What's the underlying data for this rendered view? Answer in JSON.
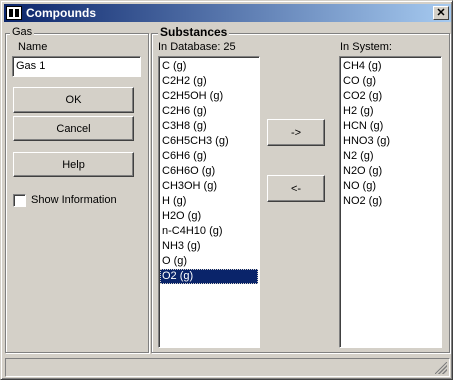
{
  "window": {
    "title": "Compounds"
  },
  "gas_group": {
    "caption": "Gas",
    "name_label": "Name",
    "name_value": "Gas 1"
  },
  "buttons": {
    "ok": "OK",
    "cancel": "Cancel",
    "help": "Help",
    "add": "->",
    "remove": "<-"
  },
  "checkbox": {
    "label": "Show Information",
    "checked": false
  },
  "substances": {
    "heading": "Substances",
    "database_label": "In Database: 25",
    "system_label": "In System:",
    "database_items": [
      "C (g)",
      "C2H2 (g)",
      "C2H5OH (g)",
      "C2H6 (g)",
      "C3H8 (g)",
      "C6H5CH3 (g)",
      "C6H6 (g)",
      "C6H6O (g)",
      "CH3OH (g)",
      "H (g)",
      "H2O (g)",
      "n-C4H10 (g)",
      "NH3 (g)",
      "O (g)",
      "O2 (g)"
    ],
    "database_selected": "O2 (g)",
    "system_items": [
      "CH4 (g)",
      "CO (g)",
      "CO2 (g)",
      "H2 (g)",
      "HCN (g)",
      "HNO3 (g)",
      "N2 (g)",
      "N2O (g)",
      "NO (g)",
      "NO2 (g)"
    ]
  },
  "icons": {
    "app": "app-icon",
    "close": "close-icon",
    "grip": "resize-grip-icon"
  },
  "colors": {
    "titlebar": "#0a246a",
    "face": "#d4d0c8",
    "selection": "#0a246a"
  }
}
